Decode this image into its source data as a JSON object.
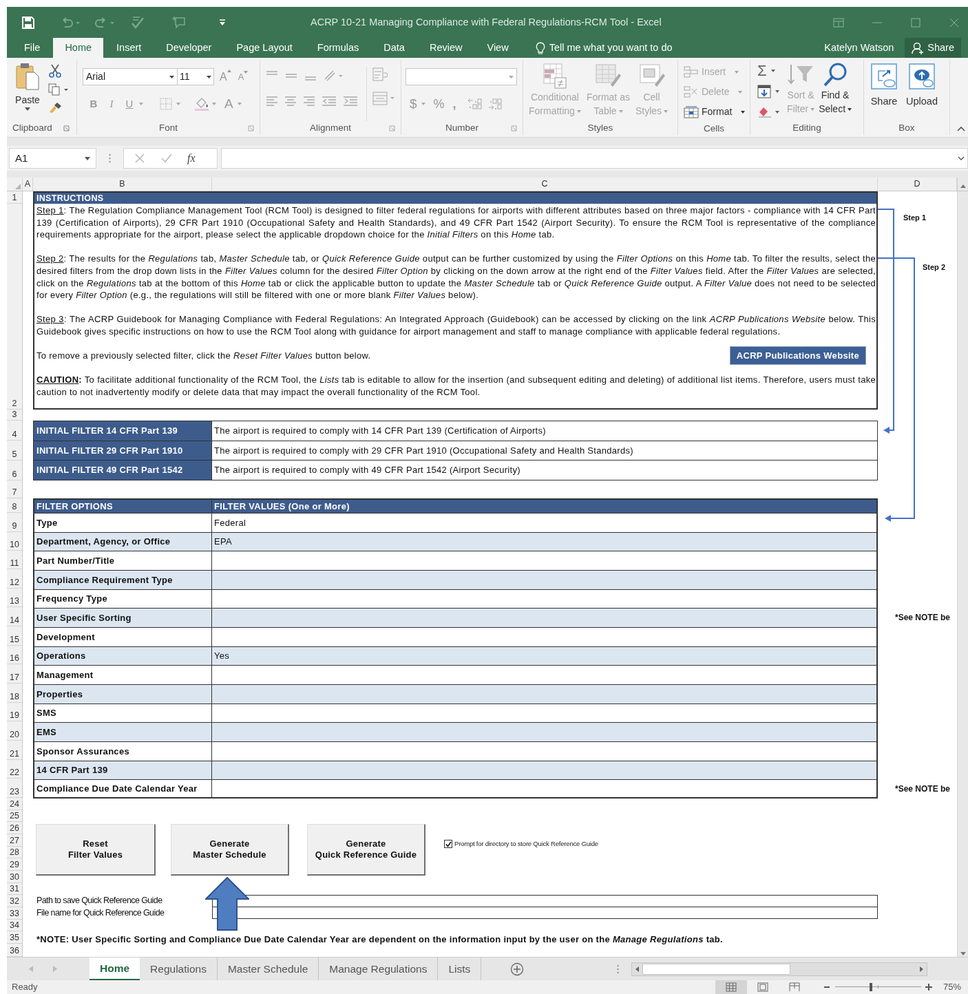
{
  "window": {
    "title": "ACRP 10-21 Managing Compliance with Federal Regulations-RCM Tool - Excel"
  },
  "ribbon_tabs": [
    {
      "label": "File",
      "selected": false
    },
    {
      "label": "Home",
      "selected": true
    },
    {
      "label": "Insert",
      "selected": false
    },
    {
      "label": "Developer",
      "selected": false
    },
    {
      "label": "Page Layout",
      "selected": false
    },
    {
      "label": "Formulas",
      "selected": false
    },
    {
      "label": "Data",
      "selected": false
    },
    {
      "label": "Review",
      "selected": false
    },
    {
      "label": "View",
      "selected": false
    }
  ],
  "tell_me": {
    "placeholder": "Tell me what you want to do"
  },
  "user": "Katelyn Watson",
  "share_button": "Share",
  "ribbon": {
    "clipboard": {
      "label": "Clipboard",
      "paste": "Paste"
    },
    "font": {
      "label": "Font",
      "font_name": "Arial",
      "font_size": "11",
      "grow": "A",
      "shrink": "A",
      "style_buttons": [
        "B",
        "I",
        "U"
      ],
      "font_color": "A"
    },
    "alignment": {
      "label": "Alignment"
    },
    "number": {
      "label": "Number",
      "currency": "$",
      "percent": "%",
      "comma": ","
    },
    "styles": {
      "label": "Styles",
      "buttons": [
        {
          "kind": "conditional",
          "lines": [
            "Conditional",
            "Formatting"
          ],
          "disabled": true
        },
        {
          "kind": "table",
          "lines": [
            "Format as",
            "Table"
          ],
          "disabled": true
        },
        {
          "kind": "cell_styles",
          "lines": [
            "Cell",
            "Styles"
          ],
          "disabled": true
        }
      ]
    },
    "cells": {
      "label": "Cells",
      "items": [
        {
          "kind": "insert",
          "label": "Insert",
          "disabled": true
        },
        {
          "kind": "delete",
          "label": "Delete",
          "disabled": true
        },
        {
          "kind": "format",
          "label": "Format",
          "disabled": false
        }
      ]
    },
    "editing": {
      "label": "Editing",
      "sum": "Σ",
      "buttons": [
        {
          "kind": "sort",
          "lines": [
            "Sort &",
            "Filter"
          ],
          "disabled": true
        },
        {
          "kind": "find",
          "lines": [
            "Find &",
            "Select"
          ],
          "disabled": false
        }
      ]
    },
    "box": {
      "label": "Box",
      "buttons": [
        {
          "kind": "share",
          "label": "Share"
        },
        {
          "kind": "upload",
          "label": "Upload"
        }
      ]
    }
  },
  "formula_bar": {
    "name_box": "A1",
    "function_label": "fx"
  },
  "columns": [
    "A",
    "B",
    "C",
    "D"
  ],
  "rows": [
    "1",
    "2",
    "3",
    "4",
    "5",
    "6",
    "7",
    "8",
    "9",
    "10",
    "11",
    "12",
    "13",
    "14",
    "15",
    "16",
    "17",
    "18",
    "19",
    "20",
    "21",
    "22",
    "23",
    "24",
    "25",
    "26",
    "27",
    "28",
    "29",
    "30",
    "31",
    "32",
    "33",
    "34",
    "35",
    "36"
  ],
  "instructions": {
    "title": "INSTRUCTIONS",
    "paragraphs": [
      {
        "kind": "step",
        "label": "Step 1",
        "text": ": The Regulation Compliance Management Tool (RCM Tool) is designed to filter federal regulations for airports with different attributes based on three major factors - compliance with 14 CFR Part 139 (Certification of Airports), 29 CFR Part 1910 (Occupational Safety and Health Standards), and 49 CFR Part 1542 (Airport Security). To ensure the RCM Tool is representative of the compliance requirements appropriate for the airport, please select the applicable dropdown choice for the *Initial Filters* on this *Home* tab."
      },
      {
        "kind": "step",
        "label": "Step 2",
        "text": ": The results for the *Regulations* tab, *Master Schedule* tab, or *Quick Reference Guide* output can be further customized by using the *Filter Options* on this *Home* tab. To filter the results, select the desired filters from the drop down lists in the *Filter Values* column for the desired *Filter Option* by clicking on the down arrow at the right end of the *Filter Values* field. After the *Filter Values* are selected, click on the *Regulations* tab at the bottom of this *Home* tab or click the applicable button to update the *Master Schedule* tab or *Quick Reference Guide* output. A *Filter Value* does not need to be selected for every *Filter Option* (e.g., the regulations will still be filtered with one or more blank *Filter Values* below)."
      },
      {
        "kind": "step",
        "label": "Step 3",
        "text": ": The ACRP Guidebook for Managing Compliance with Federal Regulations: An Integrated Approach (Guidebook) can be accessed by clicking on the link *ACRP Publications Website* below. This Guidebook gives specific instructions on how to use the RCM Tool along with guidance for airport management and staff to manage compliance with applicable federal regulations."
      },
      {
        "kind": "plain",
        "text": "To remove a previously selected filter, click the *Reset Filter Values* button below.",
        "button": "ACRP Publications Website"
      },
      {
        "kind": "caution",
        "label": "CAUTION",
        "text": "**:** To facilitate additional functionality of the RCM Tool, the *Lists* tab is editable to allow for the insertion (and subsequent editing and deleting) of additional list items. Therefore, users must take caution to not inadvertently modify or delete data that may impact the overall functionality of the RCM Tool."
      }
    ]
  },
  "connectors": [
    {
      "label": "Step 1"
    },
    {
      "label": "Step 2"
    }
  ],
  "initial_filters": [
    {
      "label": "INITIAL FILTER 14 CFR Part 139",
      "value": "The airport is required to comply with 14 CFR Part 139 (Certification of Airports)"
    },
    {
      "label": "INITIAL FILTER 29 CFR Part 1910",
      "value": "The airport is required to comply with 29 CFR Part 1910 (Occupational Safety and Health Standards)"
    },
    {
      "label": "INITIAL FILTER 49 CFR Part 1542",
      "value": "The airport is required to comply with 49 CFR Part 1542 (Airport Security)"
    }
  ],
  "filter_table": {
    "columns": [
      "FILTER OPTIONS",
      "FILTER VALUES (One or More)"
    ],
    "rows": [
      {
        "option": "Type",
        "value": "Federal"
      },
      {
        "option": "Department, Agency, or Office",
        "value": "EPA"
      },
      {
        "option": "Part Number/Title"
      },
      {
        "option": "Compliance Requirement Type"
      },
      {
        "option": "Frequency Type"
      },
      {
        "option": "User Specific Sorting",
        "side_note": "*See NOTE be"
      },
      {
        "option": "Development"
      },
      {
        "option": "Operations",
        "value": "Yes"
      },
      {
        "option": "Management"
      },
      {
        "option": "Properties"
      },
      {
        "option": "SMS"
      },
      {
        "option": "EMS"
      },
      {
        "option": "Sponsor Assurances"
      },
      {
        "option": "14 CFR Part 139"
      },
      {
        "option": "Compliance Due Date Calendar Year",
        "side_note": "*See NOTE be"
      }
    ]
  },
  "action_buttons": [
    {
      "lines": [
        "Reset",
        "Filter Values"
      ]
    },
    {
      "lines": [
        "Generate",
        "Master Schedule"
      ]
    },
    {
      "lines": [
        "Generate",
        "Quick Reference Guide"
      ]
    }
  ],
  "prompt_checkbox": {
    "label": "Prompt for directory to store Quick Reference Guide",
    "checked": true
  },
  "path_fields": [
    {
      "label": "Path to save Quick Reference Guide"
    },
    {
      "label": "File name for Quick Reference Guide"
    }
  ],
  "note": [
    {
      "text": "*NOTE: User Specific Sorting and Compliance Due Date Calendar Year are dependent on the information input by the user on the ",
      "italic": false
    },
    {
      "text": "Manage Regulations",
      "italic": true
    },
    {
      "text": " tab.",
      "italic": false
    }
  ],
  "sheet_tabs": [
    {
      "label": "Home",
      "selected": true
    },
    {
      "label": "Regulations",
      "selected": false
    },
    {
      "label": "Master Schedule",
      "selected": false
    },
    {
      "label": "Manage Regulations",
      "selected": false
    },
    {
      "label": "Lists",
      "selected": false
    }
  ],
  "status_bar": {
    "text": "Ready",
    "views": [
      {
        "kind": "normal",
        "selected": true
      },
      {
        "kind": "page_layout",
        "selected": false
      },
      {
        "kind": "page_break",
        "selected": false
      }
    ],
    "zoom_slider": {
      "level": 0.4
    },
    "zoom": "75%"
  }
}
